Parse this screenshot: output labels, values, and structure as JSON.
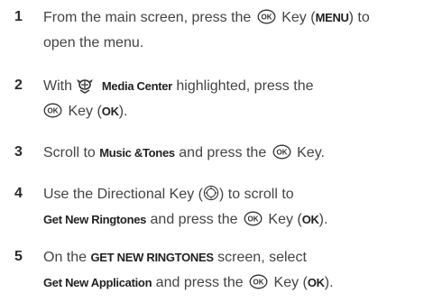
{
  "steps": [
    {
      "number": "1",
      "line1_a": "From the main screen, press the",
      "line1_b": "Key (",
      "line1_bold": "MENU",
      "line1_c": ") to",
      "line2": "open the menu."
    },
    {
      "number": "2",
      "line1_a": "With",
      "line1_bold": "Media Center",
      "line1_b": "highlighted, press the",
      "line2_a": "Key (",
      "line2_bold": "OK",
      "line2_b": ")."
    },
    {
      "number": "3",
      "line1_a": "Scroll to",
      "line1_bold": "Music &Tones",
      "line1_b": "and press the",
      "line1_c": "Key."
    },
    {
      "number": "4",
      "line1_a": "Use the Directional Key (",
      "line1_b": ") to scroll to",
      "line2_bold": "Get New Ringtones",
      "line2_a": "and press the",
      "line2_b": "Key (",
      "line2_bold2": "OK",
      "line2_c": ")."
    },
    {
      "number": "5",
      "line1_a": "On the",
      "line1_bold": "GET NEW RINGTONES",
      "line1_b": "screen, select",
      "line2_bold": "Get New Application",
      "line2_a": "and press the",
      "line2_b": "Key (",
      "line2_bold2": "OK",
      "line2_c": ")."
    }
  ],
  "icons": {
    "ok_key_label": "OK",
    "ok_key": "ok-key-icon",
    "directional_key": "directional-key-icon",
    "media_center": "media-center-icon"
  }
}
